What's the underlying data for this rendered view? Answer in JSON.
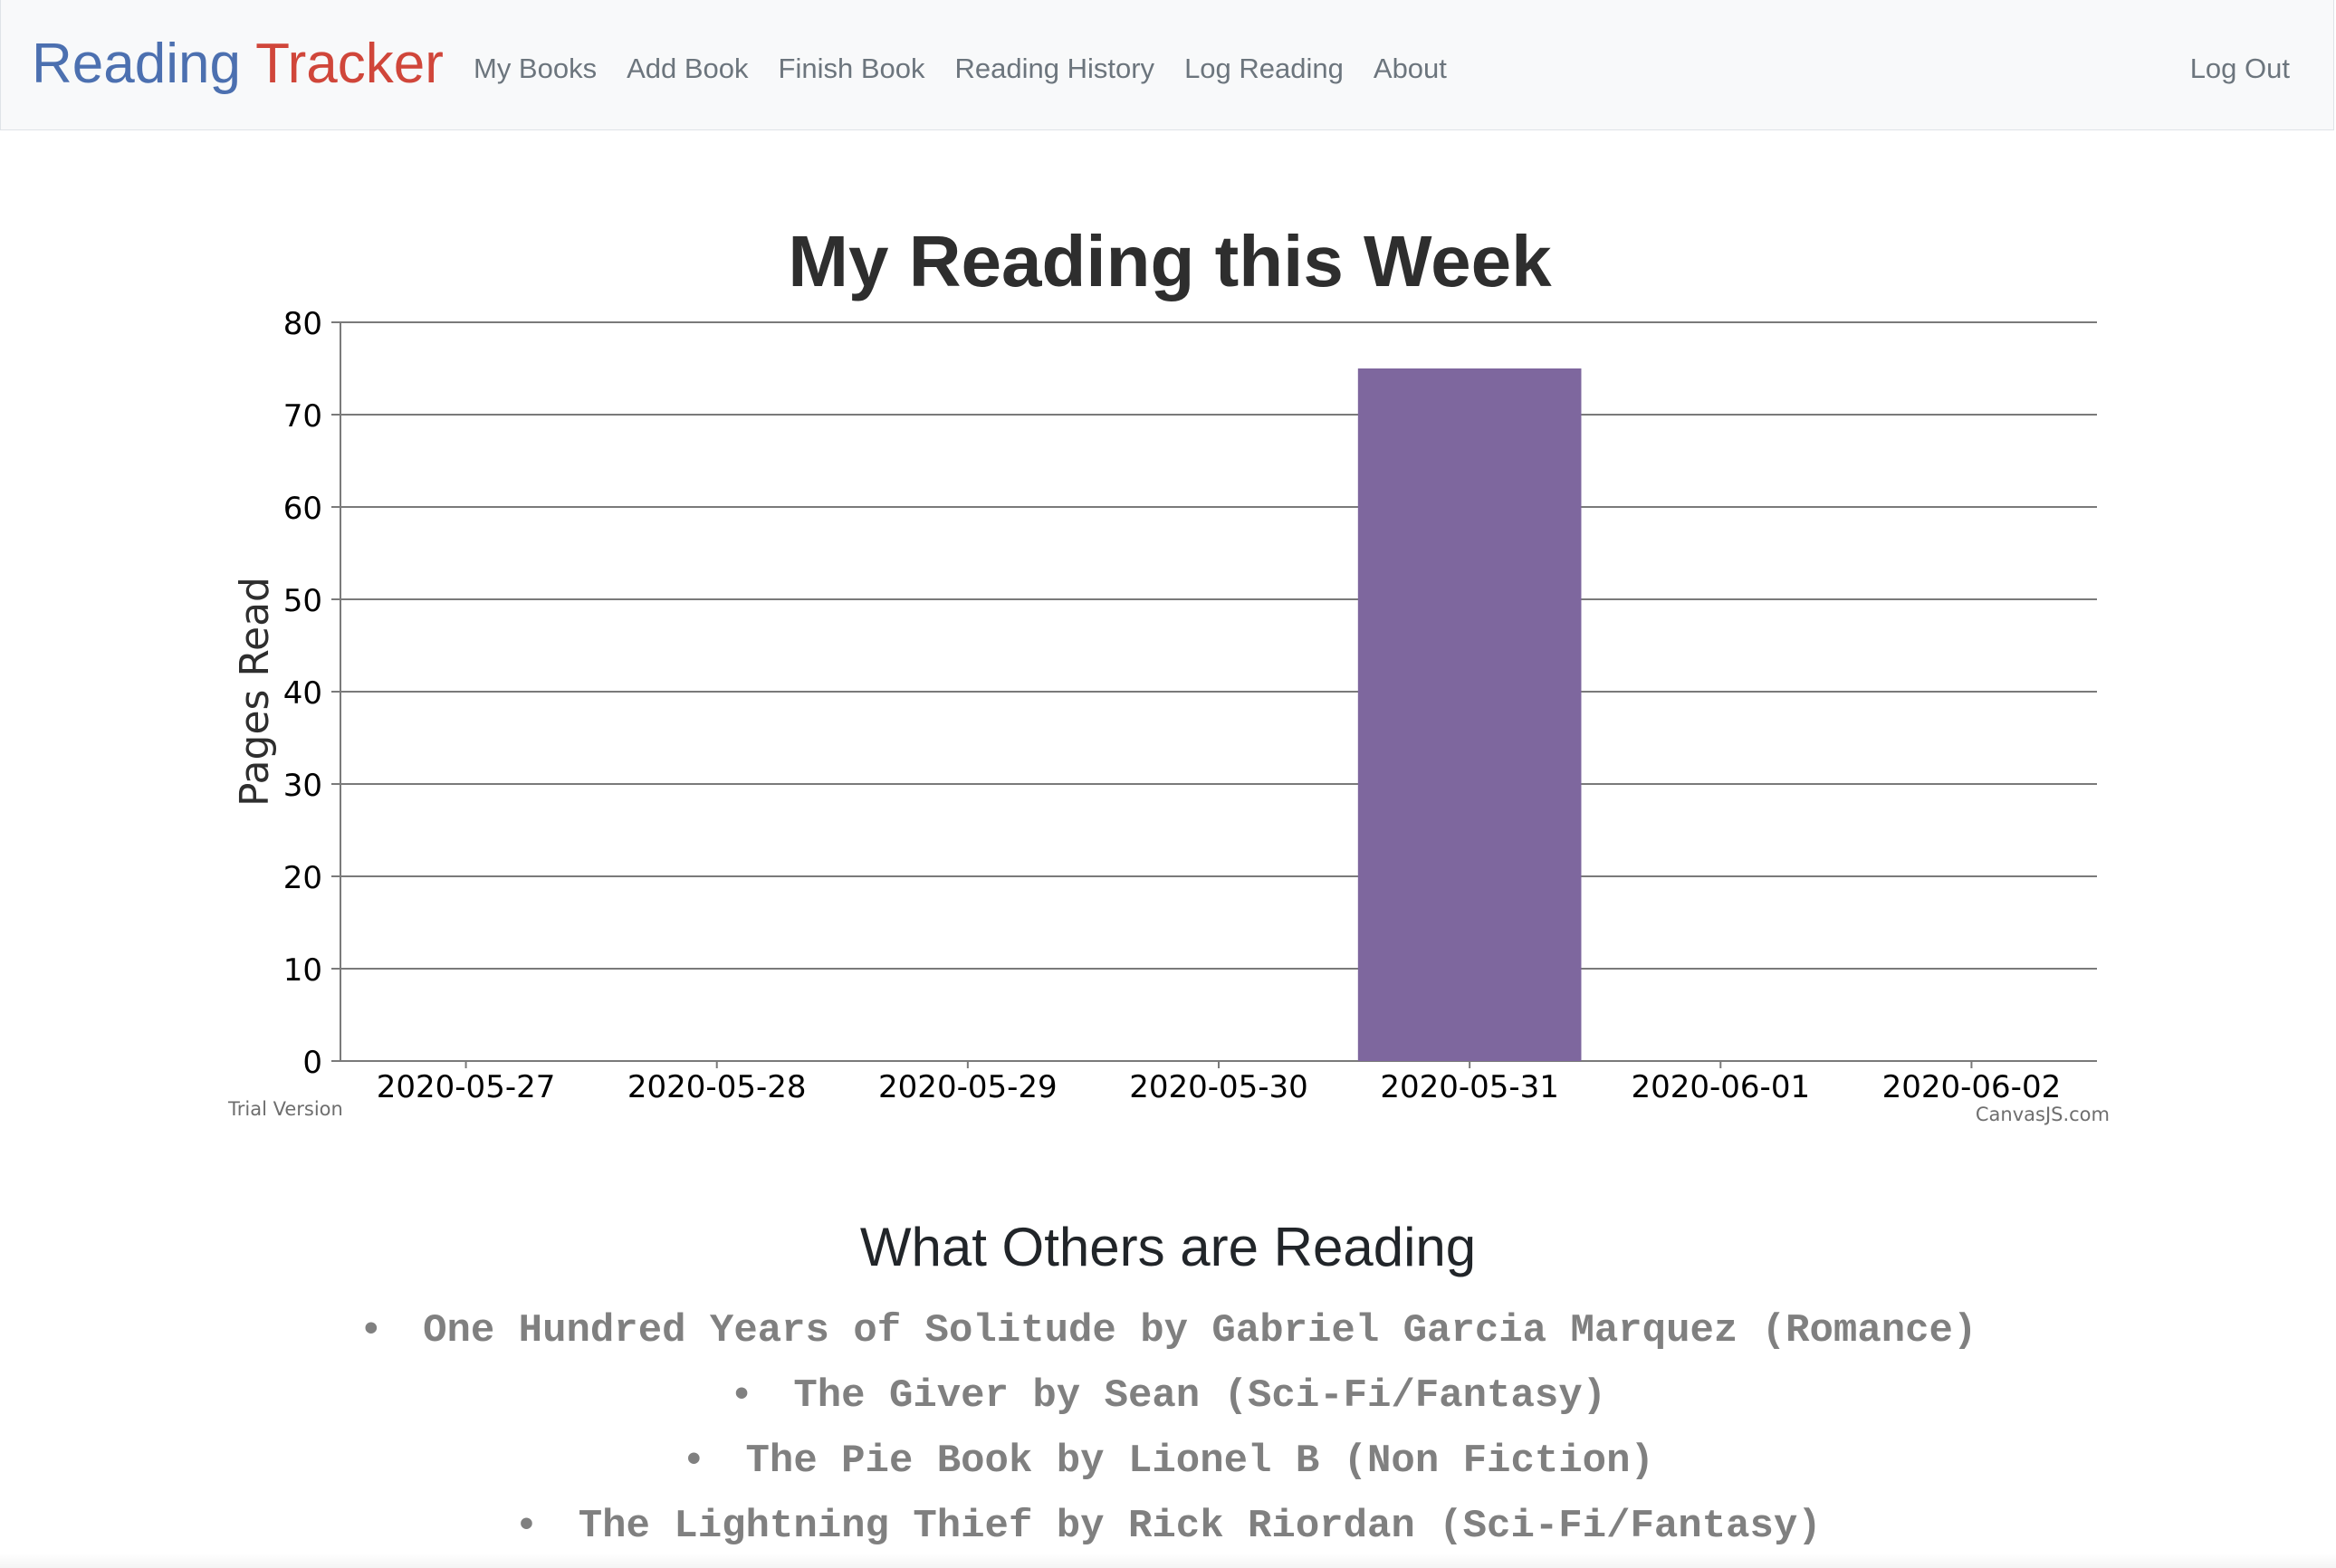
{
  "nav": {
    "brand_first": "Reading",
    "brand_second": "Tracker",
    "links": [
      "My Books",
      "Add Book",
      "Finish Book",
      "Reading History",
      "Log Reading",
      "About"
    ],
    "logout": "Log Out",
    "colors": {
      "brand_first": "#4c70b0",
      "brand_second": "#d0463a",
      "link": "#6c757d",
      "background": "#f8f9fa"
    }
  },
  "chart_data": {
    "type": "bar",
    "title": "My Reading this Week",
    "xlabel": "",
    "ylabel": "Pages Read",
    "categories": [
      "2020-05-27",
      "2020-05-28",
      "2020-05-29",
      "2020-05-30",
      "2020-05-31",
      "2020-06-01",
      "2020-06-02"
    ],
    "values": [
      0,
      0,
      0,
      0,
      75,
      0,
      0
    ],
    "ylim": [
      0,
      80
    ],
    "yticks": [
      0,
      10,
      20,
      30,
      40,
      50,
      60,
      70,
      80
    ],
    "grid": true,
    "bar_color": "#7e679e",
    "watermark_left": "Trial Version",
    "watermark_right": "CanvasJS.com"
  },
  "others": {
    "title": "What Others are Reading",
    "items": [
      "One Hundred Years of Solitude by Gabriel Garcia Marquez (Romance)",
      "The Giver by Sean (Sci-Fi/Fantasy)",
      "The Pie Book by Lionel B (Non Fiction)",
      "The Lightning Thief by Rick Riordan (Sci-Fi/Fantasy)"
    ]
  }
}
